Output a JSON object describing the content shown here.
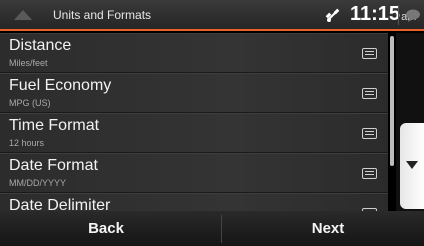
{
  "header": {
    "title": "Units and Formats",
    "time": "11:15",
    "ampm": "am",
    "accent_color": "#e8622a"
  },
  "settings": [
    {
      "label": "Distance",
      "value": "Miles/feet"
    },
    {
      "label": "Fuel Economy",
      "value": "MPG (US)"
    },
    {
      "label": "Time Format",
      "value": "12 hours"
    },
    {
      "label": "Date Format",
      "value": "MM/DD/YYYY"
    },
    {
      "label": "Date Delimiter",
      "value": ""
    }
  ],
  "footer": {
    "back_label": "Back",
    "next_label": "Next"
  }
}
